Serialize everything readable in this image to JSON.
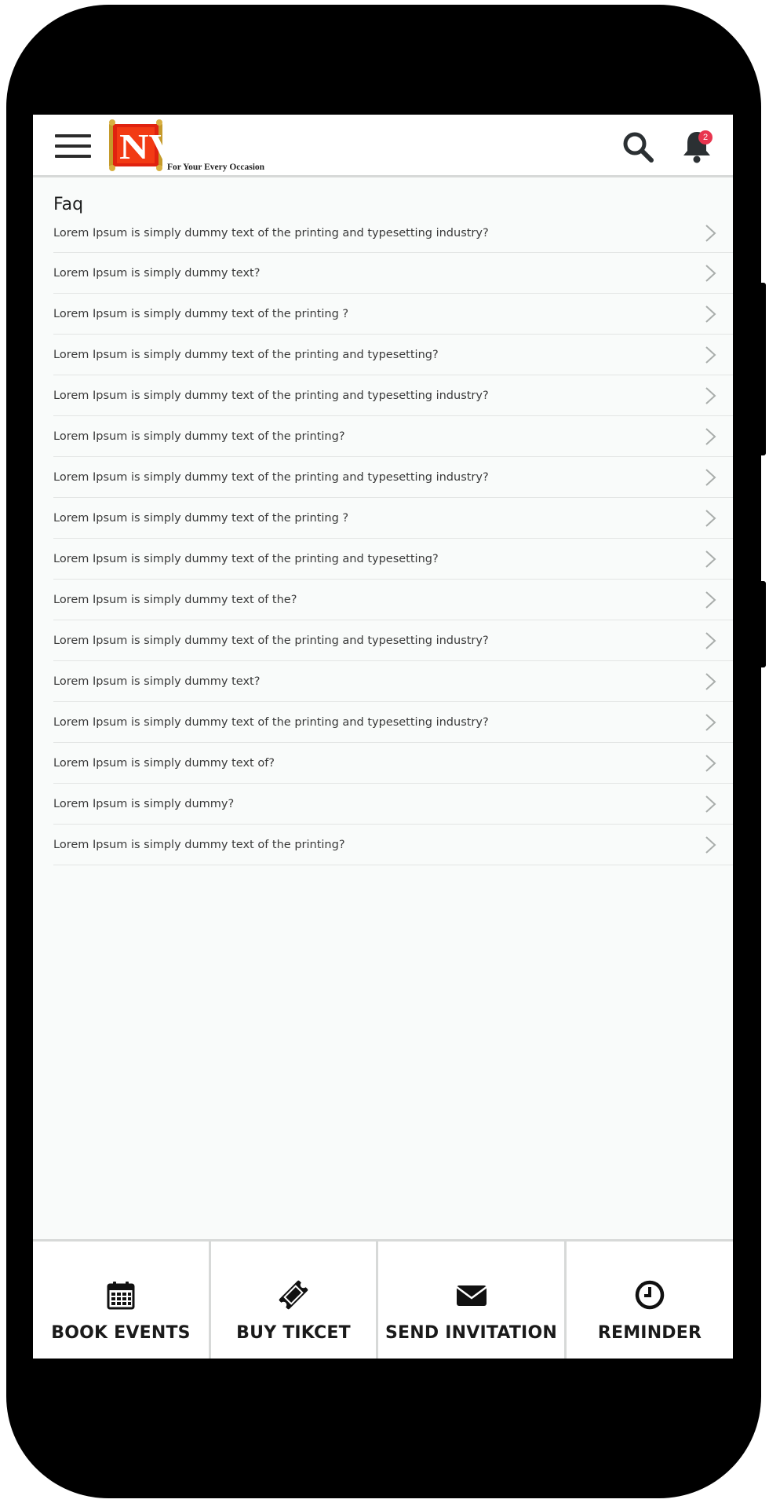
{
  "app": {
    "logo_text": "NVITEE",
    "logo_tagline": "For Your Every Occasion",
    "notification_count": "2",
    "colors": {
      "brand_red": "#e8260e",
      "badge": "#e8344e",
      "icon_dark": "#2b3033"
    }
  },
  "faq": {
    "title": "Faq",
    "items": [
      {
        "question": "Lorem Ipsum is simply dummy text of the printing and typesetting industry?"
      },
      {
        "question": "Lorem Ipsum is simply dummy text?"
      },
      {
        "question": "Lorem Ipsum is simply dummy text of the printing ?"
      },
      {
        "question": "Lorem Ipsum is simply dummy text of the printing and typesetting?"
      },
      {
        "question": "Lorem Ipsum is simply dummy text of the printing and typesetting industry?"
      },
      {
        "question": "Lorem Ipsum is simply dummy text of the printing?"
      },
      {
        "question": "Lorem Ipsum is simply dummy text of the printing and typesetting industry?"
      },
      {
        "question": "Lorem Ipsum is simply dummy text of the printing ?"
      },
      {
        "question": "Lorem Ipsum is simply dummy text of the printing and typesetting?"
      },
      {
        "question": "Lorem Ipsum is simply dummy text of the?"
      },
      {
        "question": "Lorem Ipsum is simply dummy text of the printing and typesetting industry?"
      },
      {
        "question": "Lorem Ipsum is simply dummy text?"
      },
      {
        "question": "Lorem Ipsum is simply dummy text of the printing and typesetting industry?"
      },
      {
        "question": "Lorem Ipsum is simply dummy text of?"
      },
      {
        "question": "Lorem Ipsum is simply dummy?"
      },
      {
        "question": "Lorem Ipsum is simply dummy text of the printing?"
      }
    ]
  },
  "bottom_nav": [
    {
      "label": "BOOK EVENTS",
      "icon": "calendar-icon"
    },
    {
      "label": "BUY TIKCET",
      "icon": "ticket-icon"
    },
    {
      "label": "SEND INVITATION",
      "icon": "envelope-icon"
    },
    {
      "label": "REMINDER",
      "icon": "clock-icon"
    }
  ]
}
